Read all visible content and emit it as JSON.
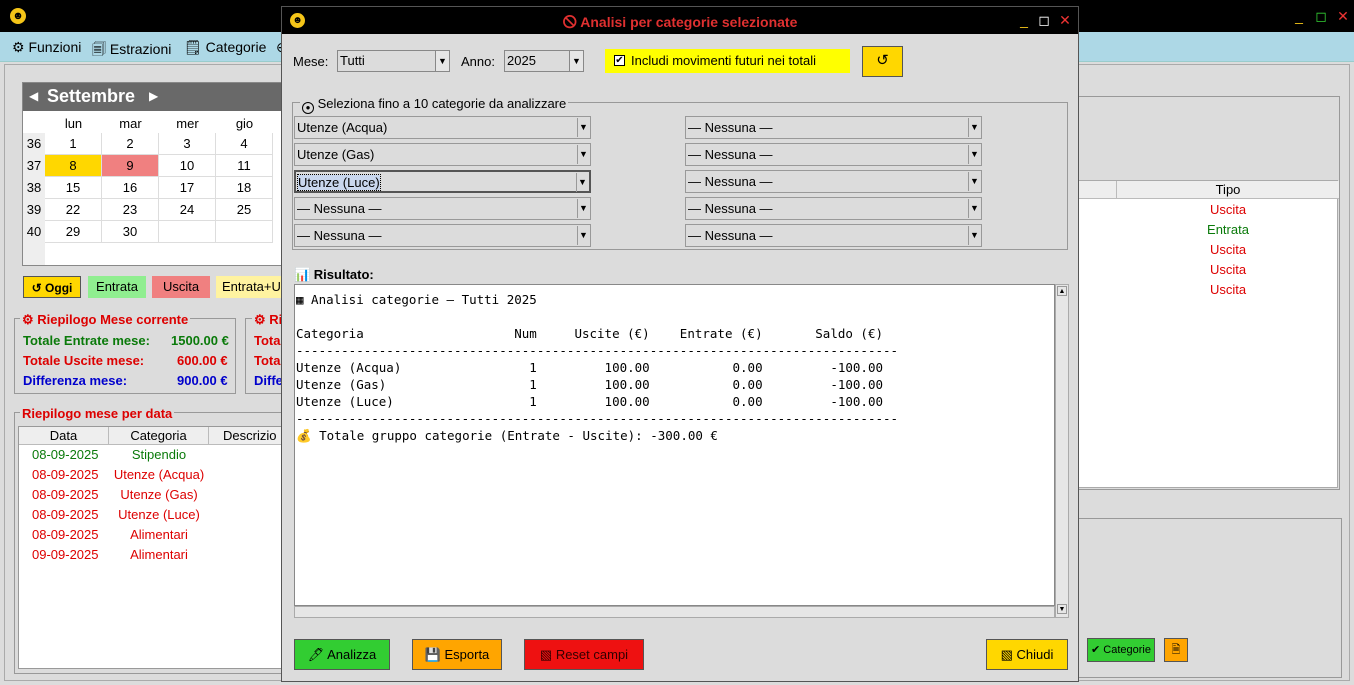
{
  "main": {
    "menu": [
      "⚙ Funzioni",
      "🗐 Estrazioni",
      "🗒 Categorie",
      "⊕"
    ],
    "calendar": {
      "month": "Settembre",
      "day_names": [
        "lun",
        "mar",
        "mer",
        "gio"
      ],
      "weeks": [
        {
          "num": "36",
          "days": [
            "1",
            "2",
            "3",
            "4"
          ]
        },
        {
          "num": "37",
          "days": [
            "8",
            "9",
            "10",
            "11"
          ]
        },
        {
          "num": "38",
          "days": [
            "15",
            "16",
            "17",
            "18"
          ]
        },
        {
          "num": "39",
          "days": [
            "22",
            "23",
            "24",
            "25"
          ]
        },
        {
          "num": "40",
          "days": [
            "29",
            "30",
            "",
            ""
          ]
        }
      ]
    },
    "buttons": {
      "today": "↺ Oggi",
      "entrata": "Entrata",
      "uscita": "Uscita",
      "entrata_uscita": "Entrata+U"
    },
    "summary": {
      "title": "⚙ Riepilogo Mese corrente",
      "title2": "⚙ Ri",
      "entrate_label": "Totale Entrate mese:",
      "entrate_value": "1500.00 €",
      "uscite_label": "Totale Uscite mese:",
      "uscite_value": "600.00 €",
      "diff_label": "Differenza mese:",
      "diff_value": "900.00 €",
      "short1": "Tota",
      "short2": "Tota",
      "short3": "Diffe"
    },
    "by_date": {
      "title": "Riepilogo mese per data",
      "headers": [
        "Data",
        "Categoria",
        "Descrizio"
      ],
      "rows": [
        {
          "date": "08-09-2025",
          "cat": "Stipendio"
        },
        {
          "date": "08-09-2025",
          "cat": "Utenze (Acqua)"
        },
        {
          "date": "08-09-2025",
          "cat": "Utenze (Gas)"
        },
        {
          "date": "08-09-2025",
          "cat": "Utenze (Luce)"
        },
        {
          "date": "08-09-2025",
          "cat": "Alimentari"
        },
        {
          "date": "09-09-2025",
          "cat": "Alimentari"
        }
      ]
    },
    "right_table": {
      "header": "Tipo",
      "rows": [
        "Uscita",
        "Entrata",
        "Uscita",
        "Uscita",
        "Uscita"
      ]
    },
    "right_buttons": {
      "categorie": "✔ Categorie",
      "extra": "🗎"
    }
  },
  "dialog": {
    "title": "🛇 Analisi per categorie selezionate",
    "mese_label": "Mese:",
    "mese_value": "Tutti",
    "anno_label": "Anno:",
    "anno_value": "2025",
    "futuri_label": "Includi movimenti futuri nei totali",
    "futuri_checked": true,
    "refresh": "↺",
    "group_title": "Seleziona fino a 10 categorie da analizzare",
    "left_categories": [
      "Utenze (Acqua)",
      "Utenze (Gas)",
      "Utenze (Luce)",
      "— Nessuna —",
      "— Nessuna —"
    ],
    "right_categories": [
      "— Nessuna —",
      "— Nessuna —",
      "— Nessuna —",
      "— Nessuna —",
      "— Nessuna —"
    ],
    "result_label": "📊 Risultato:",
    "result_text": "▦ Analisi categorie – Tutti 2025\n\nCategoria                    Num     Uscite (€)    Entrate (€)       Saldo (€)\n--------------------------------------------------------------------------------\nUtenze (Acqua)                 1         100.00           0.00         -100.00\nUtenze (Gas)                   1         100.00           0.00         -100.00\nUtenze (Luce)                  1         100.00           0.00         -100.00\n--------------------------------------------------------------------------------\n💰 Totale gruppo categorie (Entrate - Uscite): -300.00 €",
    "buttons": {
      "analizza": "🖊 Analizza",
      "esporta": "💾 Esporta",
      "reset": "▧ Reset campi",
      "chiudi": "▧ Chiudi"
    }
  },
  "colors": {
    "menubar": "#add8e6",
    "yellow": "#ffd700",
    "green": "#32cd32",
    "red": "#ee1111",
    "orange": "#ffa500"
  }
}
